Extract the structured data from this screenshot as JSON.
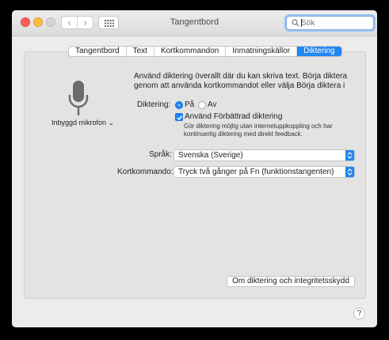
{
  "window": {
    "title": "Tangentbord"
  },
  "toolbar": {
    "back_glyph": "‹",
    "forward_glyph": "›",
    "grid_icon": "grid-icon",
    "search_placeholder": "Sök",
    "search_value": ""
  },
  "tabs": [
    {
      "label": "Tangentbord",
      "active": false
    },
    {
      "label": "Text",
      "active": false
    },
    {
      "label": "Kortkommandon",
      "active": false
    },
    {
      "label": "Inmatningskällor",
      "active": false
    },
    {
      "label": "Diktering",
      "active": true
    }
  ],
  "mic": {
    "label": "Inbyggd mikrofon ⌄",
    "icon": "microphone-icon"
  },
  "dictation": {
    "description": "Använd diktering överallt där du kan skriva text. Börja diktera genom att använda kortkommandot eller välja Börja diktera i",
    "label": "Diktering:",
    "on_label": "På",
    "off_label": "Av",
    "selected": "on",
    "enhanced_label": "Använd Förbättrad diktering",
    "enhanced_checked": true,
    "enhanced_desc": "Gör diktering möjlig utan internetuppkoppling och har kontinuerlig diktering med direkt feedback."
  },
  "language": {
    "label": "Språk:",
    "value": "Svenska (Sverige)"
  },
  "shortcut": {
    "label": "Kortkommando:",
    "value": "Tryck två gånger på Fn (funktionstangenten)"
  },
  "privacy_button": "Om diktering och integritetsskydd",
  "help_button": "?",
  "colors": {
    "accent": "#1f86f2",
    "background": "#ececec",
    "panel": "#e3e3e3"
  }
}
